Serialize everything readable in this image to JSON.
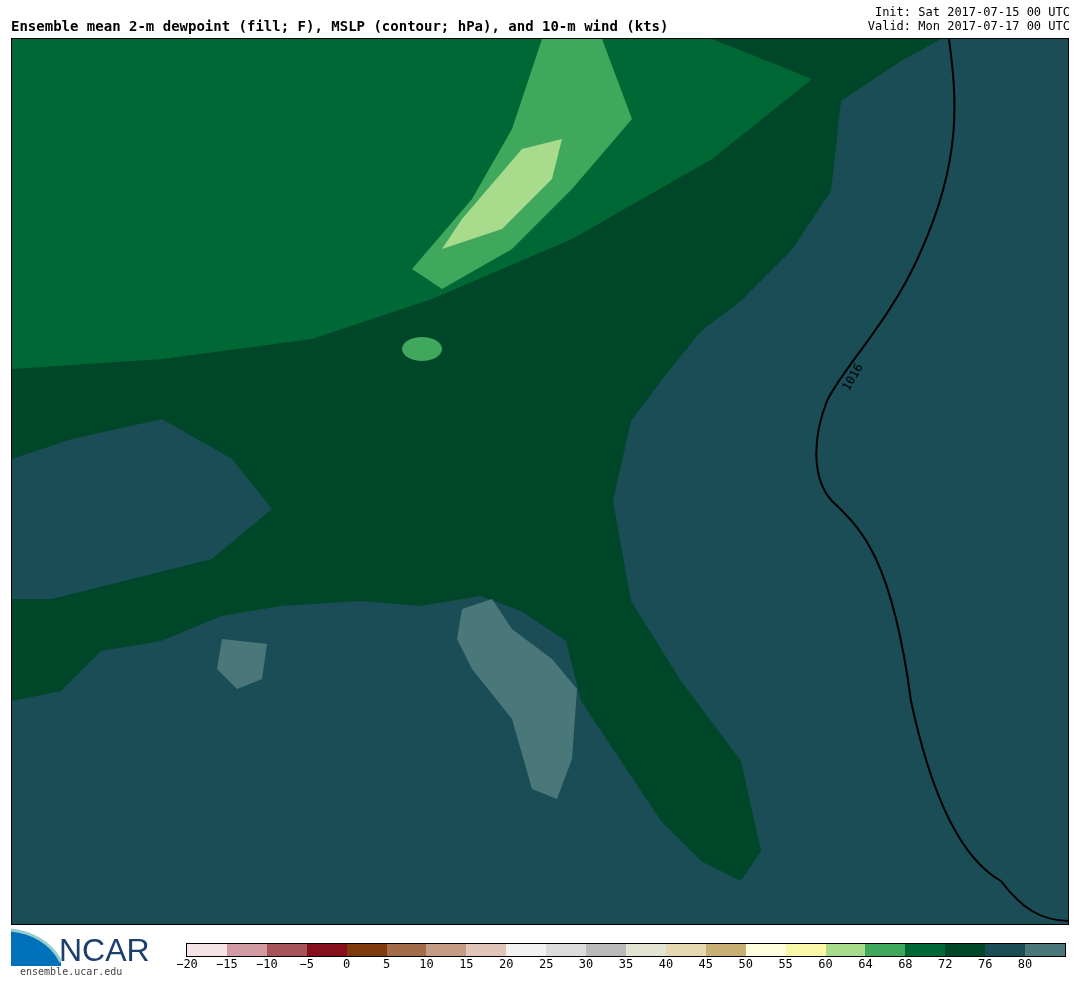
{
  "title": "Ensemble mean 2-m dewpoint (fill; F), MSLP (contour; hPa), and 10-m wind (kts)",
  "init": "Init: Sat 2017-07-15 00 UTC",
  "valid": "Valid: Mon 2017-07-17 00 UTC",
  "map": {
    "contour_label": "1016"
  },
  "logo": {
    "text": "NCAR",
    "url": "ensemble.ucar.edu"
  },
  "colorbar": [
    {
      "label": "−20",
      "color": "#f4e4e6"
    },
    {
      "label": "−15",
      "color": "#d29aa2"
    },
    {
      "label": "−10",
      "color": "#a6535a"
    },
    {
      "label": "−5",
      "color": "#860f1c"
    },
    {
      "label": "0",
      "color": "#7f3b0e"
    },
    {
      "label": "5",
      "color": "#a26b49"
    },
    {
      "label": "10",
      "color": "#c49c85"
    },
    {
      "label": "15",
      "color": "#e0c5b8"
    },
    {
      "label": "20",
      "color": "#f2f2f2"
    },
    {
      "label": "25",
      "color": "#dcdcdc"
    },
    {
      "label": "30",
      "color": "#b9b9b9"
    },
    {
      "label": "35",
      "color": "#e3e3d2"
    },
    {
      "label": "40",
      "color": "#e6d8b0"
    },
    {
      "label": "45",
      "color": "#c8b074"
    },
    {
      "label": "50",
      "color": "#ffffe0"
    },
    {
      "label": "55",
      "color": "#f8f8a8"
    },
    {
      "label": "60",
      "color": "#a8dc8c"
    },
    {
      "label": "64",
      "color": "#3fa85c"
    },
    {
      "label": "68",
      "color": "#006834"
    },
    {
      "label": "72",
      "color": "#00472a"
    },
    {
      "label": "76",
      "color": "#1a4d55"
    },
    {
      "label": "80",
      "color": "#4a777a"
    }
  ]
}
